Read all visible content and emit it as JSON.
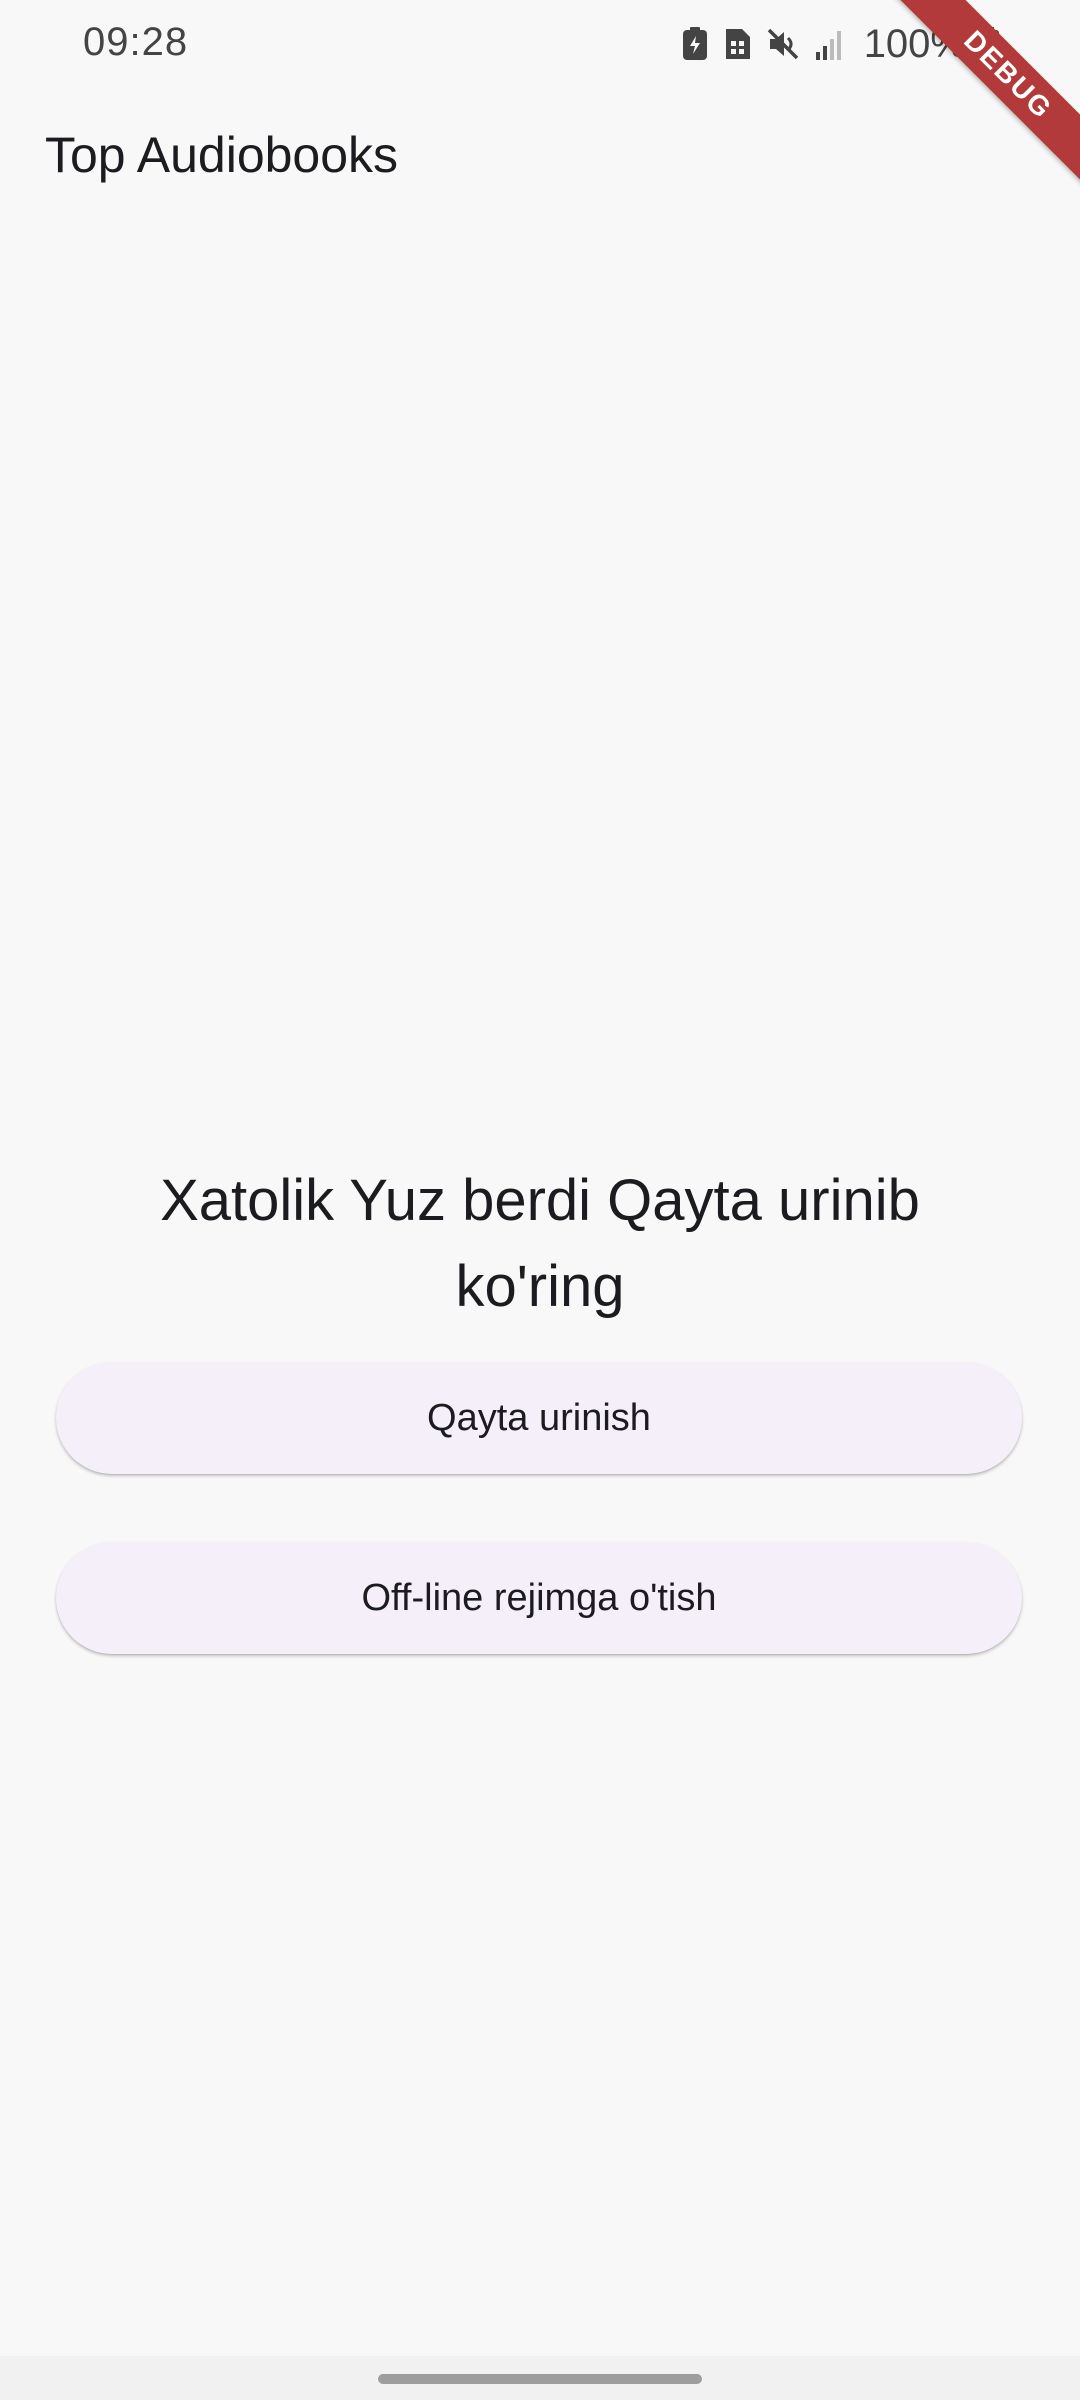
{
  "status_bar": {
    "time": "09:28",
    "battery": "100%",
    "icons": [
      "battery-saver-icon",
      "sim-card-icon",
      "mute-icon",
      "signal-icon",
      "battery-icon"
    ]
  },
  "debug_banner": {
    "label": "DEBUG"
  },
  "app_bar": {
    "title": "Top Audiobooks"
  },
  "error": {
    "message": "Xatolik Yuz berdi Qayta urinib ko'ring"
  },
  "buttons": {
    "retry_label": "Qayta urinish",
    "offline_label": "Off-line rejimga o'tish"
  },
  "colors": {
    "background": "#f8f8f8",
    "button_bg": "#f4eff9",
    "debug_ribbon": "#b23a3a",
    "text": "#1c1b1f"
  }
}
